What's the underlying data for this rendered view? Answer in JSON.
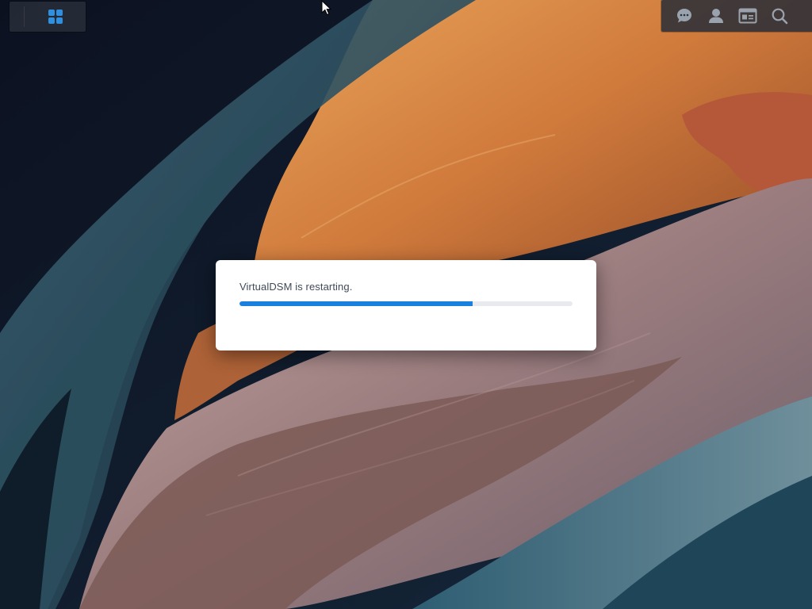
{
  "taskbar": {
    "main_menu_icon": "grid-icon",
    "tray_icons": [
      "chat-icon",
      "user-icon",
      "widgets-icon",
      "search-icon"
    ]
  },
  "dialog": {
    "message": "VirtualDSM is restarting.",
    "progress_percent": 70
  },
  "colors": {
    "accent": "#1a7fdd",
    "progress_track": "#e8eaed",
    "taskbar_bg": "#282e38"
  }
}
